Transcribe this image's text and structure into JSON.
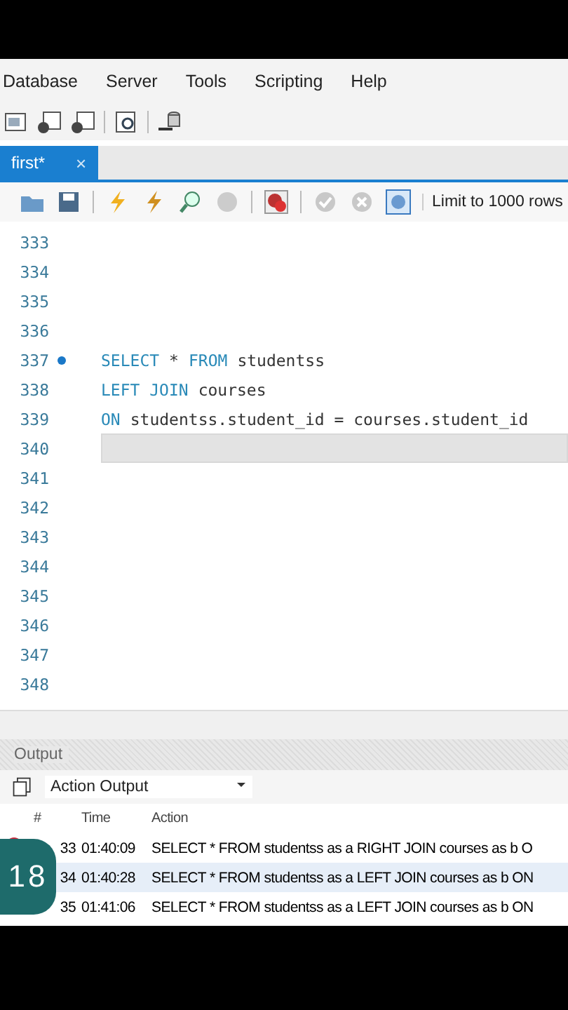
{
  "menu": [
    "Database",
    "Server",
    "Tools",
    "Scripting",
    "Help"
  ],
  "tabs": [
    {
      "label": "first*",
      "selected": true,
      "close": "×"
    }
  ],
  "limit_select": {
    "value": "Limit to 1000 rows"
  },
  "editor": {
    "lines": [
      {
        "number": "333",
        "marker": false,
        "current": false
      },
      {
        "number": "334",
        "marker": false,
        "current": false
      },
      {
        "number": "335",
        "marker": false,
        "current": false
      },
      {
        "number": "336",
        "marker": false,
        "current": false
      },
      {
        "number": "337",
        "marker": true,
        "current": false,
        "tokens": [
          {
            "text": "SELECT",
            "kind": "keyword"
          },
          {
            "text": "*",
            "kind": "plain"
          },
          {
            "text": "FROM",
            "kind": "keyword"
          },
          {
            "text": "studentss",
            "kind": "plain"
          }
        ]
      },
      {
        "number": "338",
        "marker": false,
        "current": false,
        "tokens": [
          {
            "text": "LEFT JOIN",
            "kind": "keyword"
          },
          {
            "text": "courses",
            "kind": "plain"
          }
        ]
      },
      {
        "number": "339",
        "marker": false,
        "current": false,
        "tokens": [
          {
            "text": "ON",
            "kind": "keyword"
          },
          {
            "text": "studentss.student_id = courses.student_id",
            "kind": "plain"
          }
        ]
      },
      {
        "number": "340",
        "marker": false,
        "current": true
      },
      {
        "number": "341",
        "marker": false,
        "current": false
      },
      {
        "number": "342",
        "marker": false,
        "current": false
      },
      {
        "number": "343",
        "marker": false,
        "current": false
      },
      {
        "number": "344",
        "marker": false,
        "current": false
      },
      {
        "number": "345",
        "marker": false,
        "current": false
      },
      {
        "number": "346",
        "marker": false,
        "current": false
      },
      {
        "number": "347",
        "marker": false,
        "current": false
      },
      {
        "number": "348",
        "marker": false,
        "current": false
      }
    ]
  },
  "output": {
    "title": "Output",
    "select": {
      "value": "Action Output"
    },
    "columns": [
      "#",
      "Time",
      "Action"
    ],
    "rows": [
      {
        "error": true,
        "selected": false,
        "number": "33",
        "time": "01:40:09",
        "action": "SELECT * FROM studentss as a RIGHT JOIN courses as b O"
      },
      {
        "selected": true,
        "number": "34",
        "time": "01:40:28",
        "action": "SELECT * FROM studentss as a LEFT JOIN courses as b ON"
      },
      {
        "selected": false,
        "number": "35",
        "time": "01:41:06",
        "action": "SELECT * FROM studentss as a LEFT JOIN courses as b ON"
      }
    ]
  },
  "overlay_badge": "18"
}
